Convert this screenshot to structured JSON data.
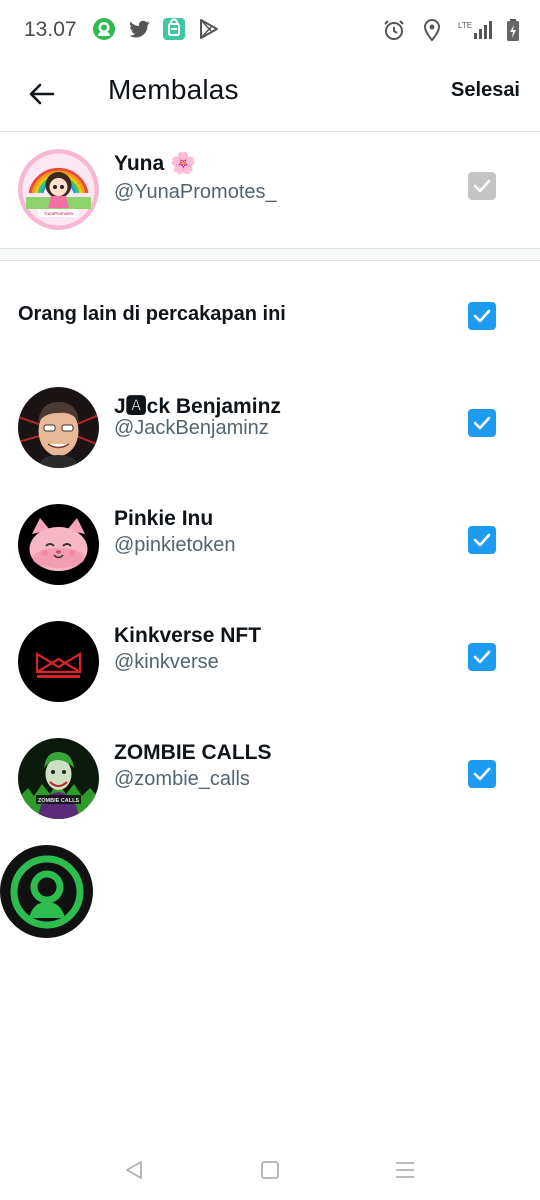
{
  "status_bar": {
    "time": "13.07",
    "left_icons": [
      "app-notification-icon",
      "twitter-icon",
      "shopping-app-icon",
      "play-store-icon"
    ],
    "right_icons": [
      "alarm-icon",
      "location-icon",
      "lte-signal-icon",
      "battery-charging-icon"
    ],
    "lte_label": "LTE"
  },
  "header": {
    "title": "Membalas",
    "done_label": "Selesai"
  },
  "primary_user": {
    "name": "Yuna 🌸",
    "handle": "@YunaPromotes_",
    "avatar_caption": "YunaPromotes",
    "checked": true,
    "disabled": true
  },
  "others": {
    "label": "Orang lain di percakapan ini",
    "checked": true
  },
  "participants": [
    {
      "name": "J🅰ck Benjaminz",
      "handle": "@JackBenjaminz",
      "checked": true
    },
    {
      "name": "Pinkie Inu",
      "handle": "@pinkietoken",
      "checked": true
    },
    {
      "name": "Kinkverse NFT",
      "handle": "@kinkverse",
      "checked": true
    },
    {
      "name": "ZOMBIE CALLS",
      "handle": "@zombie_calls",
      "checked": true,
      "avatar_caption": "ZOMBIE CALLS"
    }
  ],
  "colors": {
    "accent": "#1d9bf0",
    "text_primary": "#0f1419",
    "text_secondary": "#536471",
    "checkbox_disabled": "#c4c4c4",
    "fab_green": "#2dbd4e"
  },
  "nav_bar": {
    "icons": [
      "back-triangle-icon",
      "home-square-icon",
      "menu-lines-icon"
    ]
  }
}
